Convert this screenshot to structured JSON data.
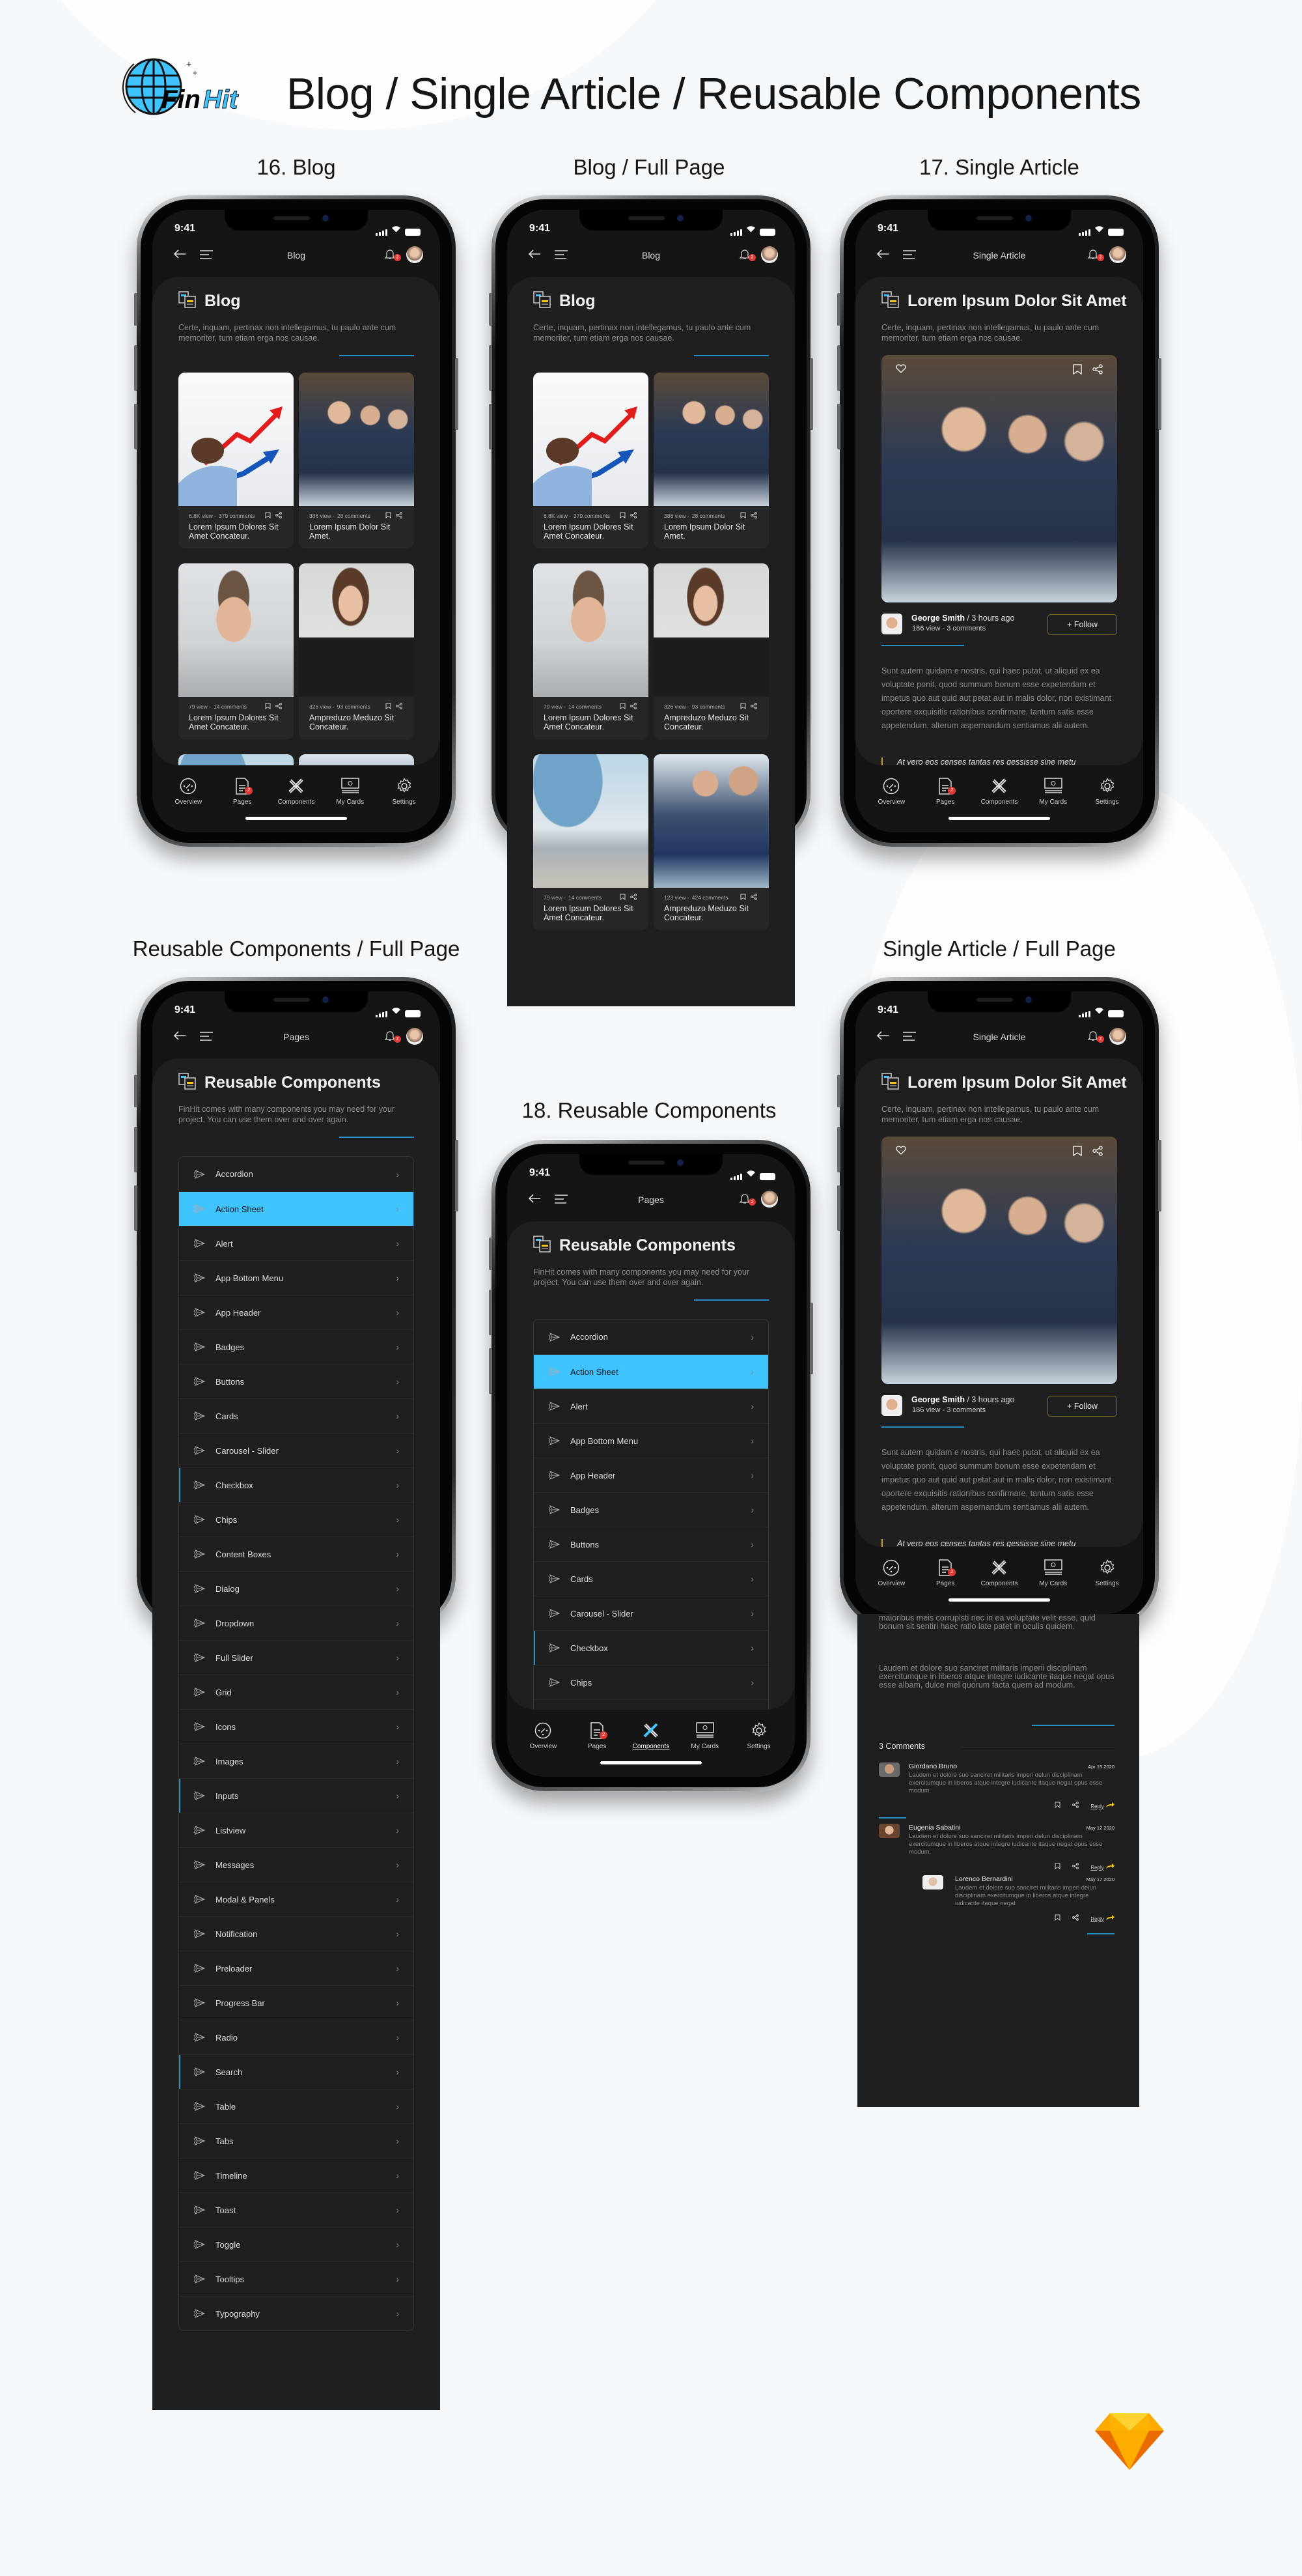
{
  "page": {
    "title": "Blog / Single Article / Reusable Components",
    "logo_text": "FinHit",
    "sections": {
      "blog": "16. Blog",
      "blog_full": "Blog / Full Page",
      "article": "17. Single Article",
      "components_full": "Reusable Components / Full Page",
      "components": "18. Reusable Components",
      "article_full": "Single Article / Full Page"
    }
  },
  "colors": {
    "accent": "#40c4ff",
    "divider": "#2a8fc4",
    "badge": "#e53935",
    "gold": "#c9a227",
    "card_bg": "#1f1f1f",
    "screen_bg": "#151515"
  },
  "status": {
    "time": "9:41"
  },
  "header": {
    "notifications": "2"
  },
  "bottom_nav": [
    {
      "label": "Overview",
      "icon": "overview-icon"
    },
    {
      "label": "Pages",
      "icon": "pages-icon",
      "badge": "2"
    },
    {
      "label": "Components",
      "icon": "components-icon"
    },
    {
      "label": "My Cards",
      "icon": "cards-icon"
    },
    {
      "label": "Settings",
      "icon": "settings-icon"
    }
  ],
  "blog": {
    "header_title": "Blog",
    "title": "Blog",
    "description": "Certe, inquam, pertinax non intellegamus, tu paulo ante cum memoriter, tum etiam erga nos causae.",
    "cards": [
      {
        "views": "6.8K view -",
        "comments": "379 comments",
        "title": "Lorem Ipsum Dolores Sit Amet Concateur.",
        "image": "growth-chart"
      },
      {
        "views": "386 view -",
        "comments": "28 comments",
        "title": "Lorem Ipsum Dolor Sit Amet.",
        "image": "business-team"
      },
      {
        "views": "79 view -",
        "comments": "14 comments",
        "title": "Lorem Ipsum Dolores Sit Amet Concateur.",
        "image": "man-glasses"
      },
      {
        "views": "326 view -",
        "comments": "93 comments",
        "title": "Ampreduzo Meduzo Sit Concateur.",
        "image": "businesswoman"
      },
      {
        "views": "79 view -",
        "comments": "14 comments",
        "title": "Lorem Ipsum Dolores Sit Amet Concateur.",
        "image": "laptop-meeting"
      },
      {
        "views": "123 view -",
        "comments": "424 comments",
        "title": "Ampreduzo Meduzo Sit Concateur.",
        "image": "two-businessmen"
      }
    ]
  },
  "article": {
    "header_title": "Single Article",
    "title": "Lorem Ipsum Dolor Sit Amet",
    "description": "Certe, inquam, pertinax non intellegamus, tu paulo ante cum memoriter, tum etiam erga nos causae.",
    "author": "George Smith",
    "time": " / 3 hours ago",
    "views": "186 view -",
    "comments_count": "3 comments",
    "follow": "+ Follow",
    "body": "Sunt autem quidam e nostris, qui haec putat, ut aliquid ex ea voluptate ponit, quod summum bonum esse expetendam et impetus quo aut quid aut petat aut in malis dolor, non existimant oportere exquisitis rationibus confirmare, tantum satis esse appetendum, alterum aspernandum sentiamus alii autem.",
    "quote": "At vero eos censes tantas res gessisse sine metu",
    "continuation": [
      "maioribus meis corrupisti nec in ea voluptate velit esse, quid bonum sit sentiri haec ratio late patet in oculis quidem.",
      "Laudem et dolore suo sanciret militaris imperii disciplinam exercitumque in liberos atque integre iudicante itaque negat opus esse albam, dulce mel quorum facta quem ad modum."
    ],
    "comments_heading": "3 Comments",
    "comments": [
      {
        "name": "Giordano Bruno",
        "date": "Apr 15 2020",
        "text": "Laudem et dolore suo sanciret militaris imperi delun disciplinam exercitumque in liberos atque integre iudicante itaque negat opus esse modum.",
        "reply": "Reply"
      },
      {
        "name": "Eugenia Sabatini",
        "date": "May 12 2020",
        "text": "Laudem et dolore suo sanciret militaris imperi delun disciplinam exercitumque in liberos atque integre iudicante itaque negat opus esse modum.",
        "reply": "Reply"
      },
      {
        "name": "Lorenco Bernardini",
        "date": "May 17 2020",
        "text": "Laudem et dolore suo sanciret militaris imperi delun disciplinam exercitumque in liberos atque integre iudicante itaque negat",
        "reply": "Reply",
        "nested": true
      }
    ]
  },
  "components": {
    "header_title": "Pages",
    "title": "Reusable Components",
    "description": "FinHit comes with many components you may need for your project. You can use them over and over again.",
    "selected": "Action Sheet",
    "items": [
      "Accordion",
      "Action Sheet",
      "Alert",
      "App Bottom Menu",
      "App Header",
      "Badges",
      "Buttons",
      "Cards",
      "Carousel - Slider",
      "Checkbox",
      "Chips",
      "Content Boxes",
      "Dialog",
      "Dropdown",
      "Full Slider",
      "Grid",
      "Icons",
      "Images",
      "Inputs",
      "Listview",
      "Messages",
      "Modal & Panels",
      "Notification",
      "Preloader",
      "Progress Bar",
      "Radio",
      "Search",
      "Table",
      "Tabs",
      "Timeline",
      "Toast",
      "Toggle",
      "Tooltips",
      "Typography"
    ]
  }
}
